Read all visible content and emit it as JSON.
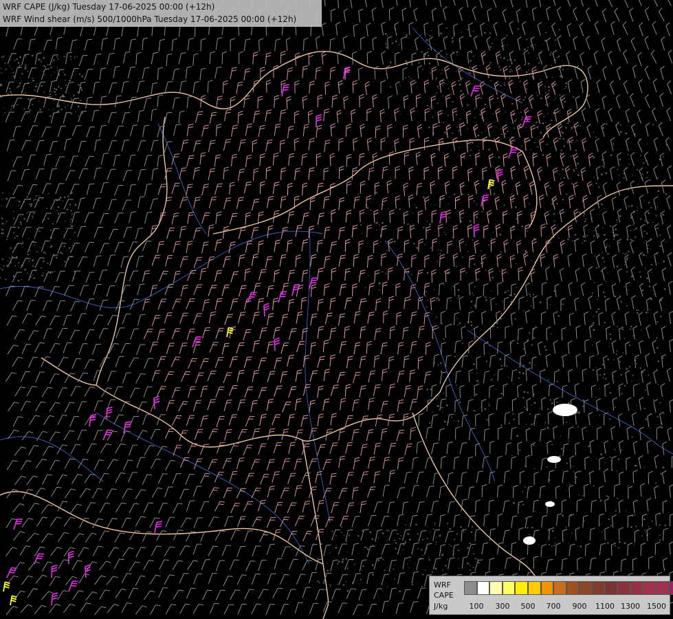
{
  "header": {
    "line1": "WRF CAPE (J/kg) Tuesday 17-06-2025 00:00 (+12h)",
    "line2": "WRF Wind shear (m/s) 500/1000hPa Tuesday 17-06-2025 00:00 (+12h)"
  },
  "legend": {
    "label_model": "WRF",
    "label_field": "CAPE",
    "label_unit": "J/kg",
    "colors": [
      "#8c8c8c",
      "#ffffff",
      "#ffffb0",
      "#ffff66",
      "#ffee00",
      "#ffcc00",
      "#f29500",
      "#c86e1e",
      "#a0521e",
      "#8c4628",
      "#823c2d",
      "#7d3232",
      "#8c323c",
      "#963246",
      "#a0324b",
      "#a03250",
      "#96285a",
      "#8c1e64",
      "#821469",
      "#780a6e"
    ],
    "tick_labels": [
      "100",
      "300",
      "500",
      "700",
      "900",
      "1100",
      "1300",
      "1500"
    ]
  },
  "map_style": {
    "background": "#000000",
    "border_color": "#f0c8a0",
    "river_color": "#3c64c8",
    "barb_low_color": "#8c8c8c",
    "barb_mid_color": "#d29696",
    "barb_high_color": "#e6a0a0",
    "cape_high_color": "#e632e6",
    "cape_yellow_color": "#ffff32"
  }
}
